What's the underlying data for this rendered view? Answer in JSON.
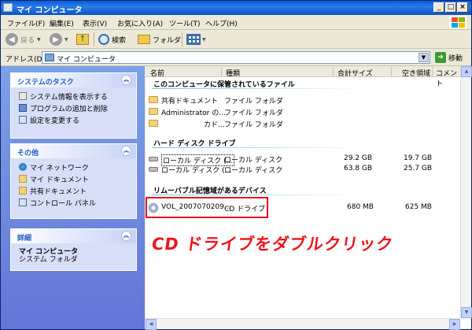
{
  "window": {
    "title": "マイ コンピュータ"
  },
  "menu": [
    "ファイル(F)",
    "編集(E)",
    "表示(V)",
    "お気に入り(A)",
    "ツール(T)",
    "ヘルプ(H)"
  ],
  "toolbar": {
    "back": "戻る",
    "search": "検索",
    "folders": "フォルダ"
  },
  "address": {
    "label": "アドレス(D)",
    "value": "マイ コンピュータ",
    "go": "移動"
  },
  "sidebar": {
    "system_tasks": {
      "title": "システムのタスク",
      "items": [
        "システム情報を表示する",
        "プログラムの追加と削除",
        "設定を変更する"
      ]
    },
    "other": {
      "title": "その他",
      "items": [
        "マイ ネットワーク",
        "マイ ドキュメント",
        "共有ドキュメント",
        "コントロール パネル"
      ]
    },
    "details": {
      "title": "詳細",
      "name": "マイ コンピュータ",
      "type": "システム フォルダ"
    }
  },
  "columns": [
    "名前",
    "種類",
    "合計サイズ",
    "空き領域",
    "コメント"
  ],
  "groups": {
    "files": {
      "title": "このコンピュータに保管されているファイル",
      "items": [
        {
          "name": "共有ドキュメント",
          "type": "ファイル フォルダ"
        },
        {
          "name": "Administrator の...",
          "type": "ファイル フォルダ"
        },
        {
          "name": "カド...",
          "type": "ファイル フォルダ"
        }
      ]
    },
    "hdd": {
      "title": "ハード ディスク ドライブ",
      "items": [
        {
          "name": "ローカル ディスク (...",
          "type": "ローカル ディスク",
          "total": "29.2 GB",
          "free": "19.7 GB"
        },
        {
          "name": "ローカル ディスク (...",
          "type": "ローカル ディスク",
          "total": "63.8 GB",
          "free": "25.7 GB"
        }
      ]
    },
    "removable": {
      "title": "リムーバブル記憶域があるデバイス",
      "items": [
        {
          "name": "VOL_2007070209...",
          "type": "CD ドライブ",
          "total": "680 MB",
          "free": "625 MB"
        }
      ]
    }
  },
  "annotation": "CD ドライブをダブルクリック",
  "colors": {
    "highlight": "#e8161c",
    "annotation": "#f0141c",
    "title_bar": "#0a5bd6"
  }
}
